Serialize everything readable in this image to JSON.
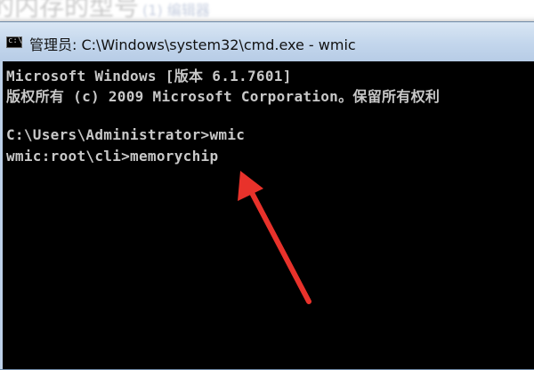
{
  "background": {
    "heading": "的内存的型号",
    "subtext": "(1) 编辑器"
  },
  "window": {
    "title": "管理员: C:\\Windows\\system32\\cmd.exe - wmic",
    "icon": "cmd-icon",
    "console_lines": [
      "Microsoft Windows [版本 6.1.7601]",
      "版权所有 (c) 2009 Microsoft Corporation。保留所有权利",
      "",
      "C:\\Users\\Administrator>wmic",
      "wmic:root\\cli>memorychip"
    ]
  },
  "annotation": {
    "type": "red-arrow",
    "color": "#e8322b"
  }
}
